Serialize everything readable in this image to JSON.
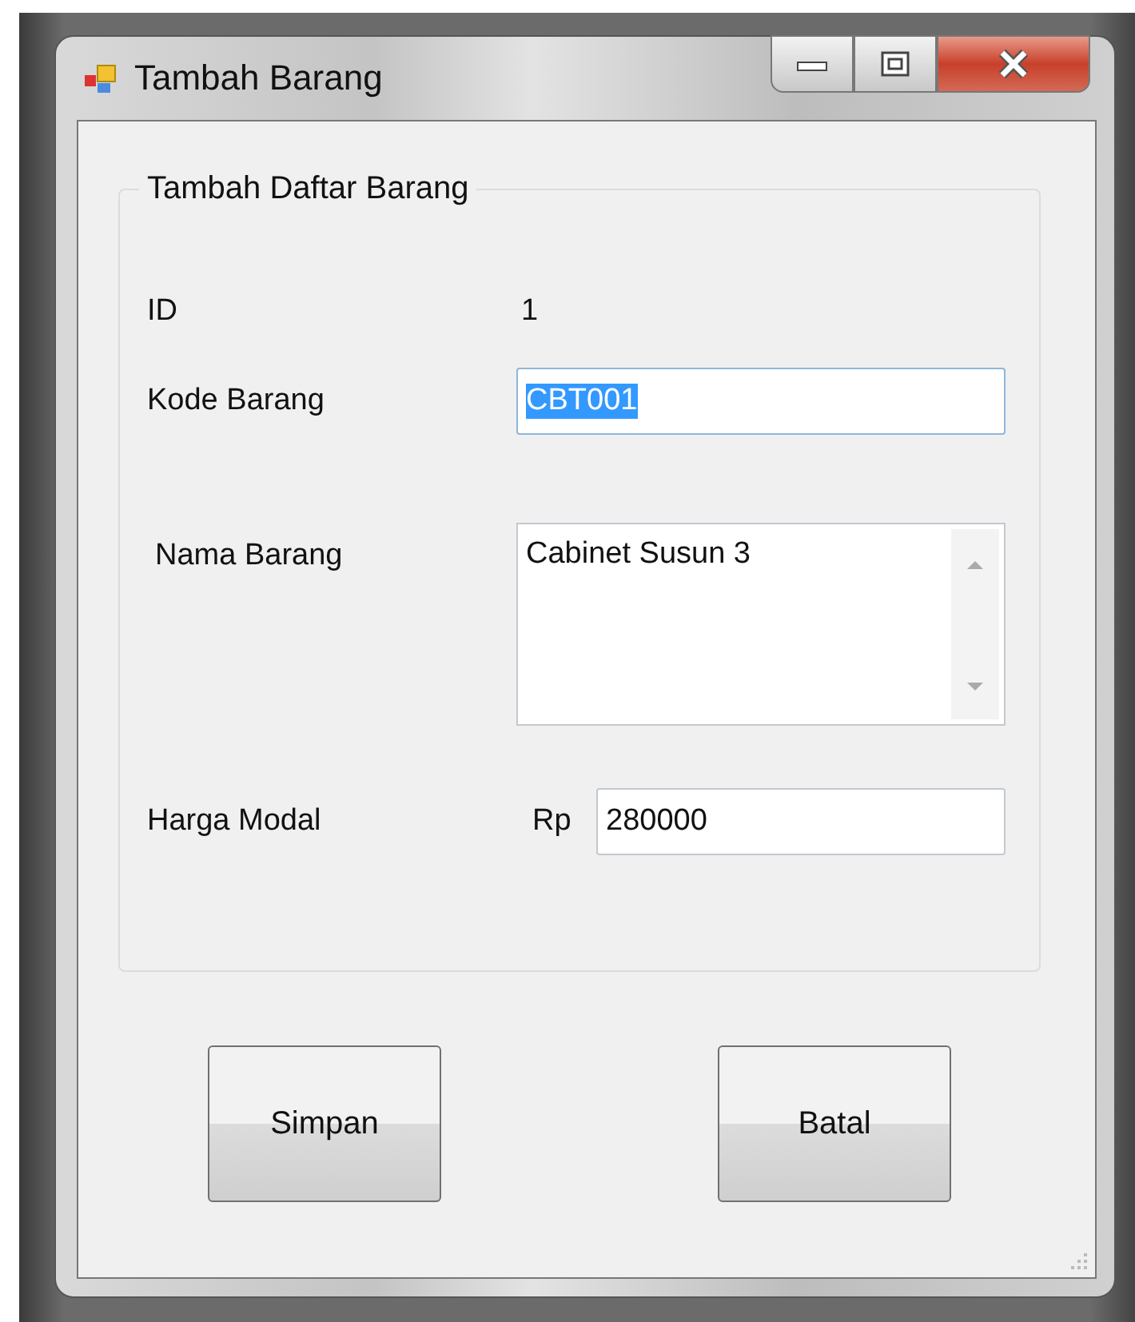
{
  "window": {
    "title": "Tambah Barang",
    "controls": [
      {
        "kind": "minimize"
      },
      {
        "kind": "maximize"
      },
      {
        "kind": "close"
      }
    ]
  },
  "group": {
    "title": "Tambah Daftar Barang"
  },
  "fields": [
    {
      "kind": "static",
      "label": "ID",
      "value": "1"
    },
    {
      "kind": "text",
      "label": "Kode Barang",
      "value": "CBT001",
      "text_selected": true
    },
    {
      "kind": "multiline",
      "label": "Nama Barang",
      "value": "Cabinet Susun 3"
    },
    {
      "kind": "text",
      "label": "Harga Modal",
      "prefix": "Rp",
      "value": "280000",
      "text_selected": false
    }
  ],
  "buttons": [
    "Simpan",
    "Batal"
  ]
}
